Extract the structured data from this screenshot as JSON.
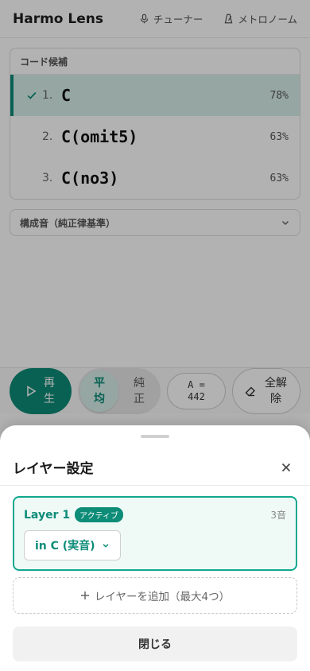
{
  "app": {
    "title": "Harmo Lens",
    "tuner_label": "チューナー",
    "metronome_label": "メトロノーム"
  },
  "chord_panel": {
    "header": "コード候補",
    "candidates": [
      {
        "rank": "1.",
        "name": "C",
        "pct": "78%",
        "selected": true
      },
      {
        "rank": "2.",
        "name": "C(omit5)",
        "pct": "63%",
        "selected": false
      },
      {
        "rank": "3.",
        "name": "C(no3)",
        "pct": "63%",
        "selected": false
      }
    ]
  },
  "notes_accordion": {
    "label": "構成音（純正律基準）"
  },
  "controls": {
    "play_label": "再生",
    "tuning_equal": "平均",
    "tuning_just": "純正",
    "pitch_line1": "A =",
    "pitch_line2": "442",
    "clear_label": "全解除"
  },
  "sheet": {
    "title": "レイヤー設定",
    "layer": {
      "name": "Layer 1",
      "badge": "アクティブ",
      "note_count": "3音",
      "key_value": "in C (実音)"
    },
    "add_layer_label": "レイヤーを追加（最大4つ）",
    "close_label": "閉じる"
  },
  "colors": {
    "accent": "#0d8c78",
    "accent_light": "#d7f0ea",
    "active_border": "#11a88e"
  }
}
